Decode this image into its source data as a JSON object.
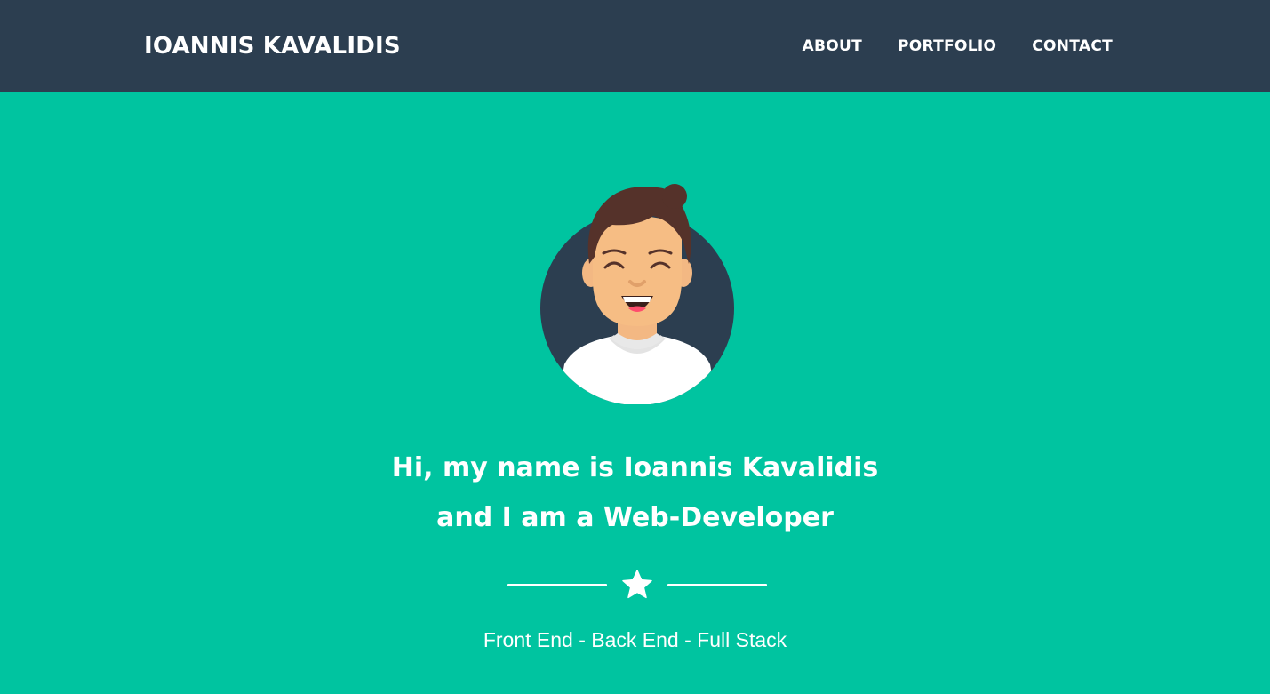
{
  "navbar": {
    "brand": "IOANNIS KAVALIDIS",
    "links": [
      "ABOUT",
      "PORTFOLIO",
      "CONTACT"
    ]
  },
  "masthead": {
    "avatar_icon": "avatar-illustration",
    "heading_line1": "Hi, my name is Ioannis Kavalidis",
    "heading_line2": "and I am a Web-Developer",
    "divider_icon": "star-icon",
    "subheading": "Front End - Back End - Full Stack"
  },
  "colors": {
    "navbar_bg": "#2c3e50",
    "masthead_bg": "#00c4a0",
    "text": "#ffffff"
  }
}
